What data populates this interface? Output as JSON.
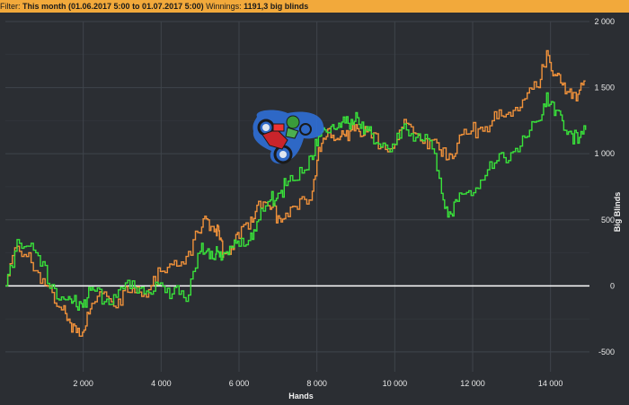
{
  "filter_bar": {
    "label": "Filter:",
    "period": "This month (01.06.2017 5:00 to 01.07.2017 5:00)",
    "winnings_label": "Winnings:",
    "winnings_value": "1191,3 big blinds"
  },
  "colors": {
    "background": "#2b2e33",
    "grid": "#3f444b",
    "series_orange": "#f0913a",
    "series_green": "#39e23a",
    "zero_line": "#ffffff",
    "filter_bar": "#f2a93b"
  },
  "icons": {
    "mascot": "motorbike-rider-icon"
  },
  "chart_data": {
    "type": "line",
    "xlabel": "Hands",
    "ylabel": "Big Blinds",
    "xlim": [
      0,
      15000
    ],
    "ylim": [
      -650,
      2000
    ],
    "x_ticks": [
      2000,
      4000,
      6000,
      8000,
      10000,
      12000,
      14000
    ],
    "x_tick_labels": [
      "2 000",
      "4 000",
      "6 000",
      "8 000",
      "10 000",
      "12 000",
      "14 000"
    ],
    "y_ticks": [
      -500,
      0,
      500,
      1000,
      1500,
      2000
    ],
    "y_tick_labels": [
      "-500",
      "0",
      "500",
      "1 000",
      "1 500",
      "2 000"
    ],
    "grid": true,
    "zero_line": 0,
    "series": [
      {
        "color": "#f0913a",
        "x": [
          0,
          300,
          600,
          900,
          1200,
          1500,
          1700,
          1900,
          2100,
          2300,
          2600,
          2900,
          3200,
          3500,
          3800,
          4100,
          4400,
          4700,
          5000,
          5200,
          5400,
          5500,
          5600,
          5800,
          6000,
          6300,
          6500,
          6800,
          7000,
          7200,
          7500,
          7800,
          8000,
          8200,
          8400,
          8600,
          8800,
          9000,
          9200,
          9400,
          9700,
          10000,
          10300,
          10600,
          10900,
          11200,
          11400,
          11600,
          11900,
          12200,
          12500,
          12800,
          13100,
          13400,
          13700,
          13900,
          14100,
          14300,
          14500,
          14700,
          14900
        ],
        "y": [
          0,
          300,
          250,
          20,
          -50,
          -150,
          -350,
          -380,
          -200,
          -120,
          -80,
          -100,
          -50,
          -80,
          70,
          100,
          150,
          260,
          400,
          500,
          430,
          350,
          250,
          300,
          360,
          520,
          640,
          580,
          530,
          550,
          580,
          650,
          950,
          1110,
          1140,
          1130,
          1100,
          1220,
          1140,
          1120,
          1080,
          1070,
          1230,
          1140,
          1100,
          980,
          1000,
          1080,
          1150,
          1200,
          1250,
          1280,
          1350,
          1460,
          1500,
          1780,
          1600,
          1520,
          1490,
          1450,
          1550
        ]
      },
      {
        "color": "#39e23a",
        "x": [
          0,
          300,
          600,
          900,
          1200,
          1500,
          1700,
          1900,
          2100,
          2300,
          2600,
          2900,
          3200,
          3500,
          3800,
          4100,
          4400,
          4700,
          5000,
          5200,
          5400,
          5500,
          5600,
          5800,
          6000,
          6300,
          6500,
          6800,
          7000,
          7200,
          7500,
          7800,
          8000,
          8200,
          8400,
          8600,
          8800,
          9000,
          9200,
          9400,
          9700,
          10000,
          10300,
          10600,
          10900,
          11200,
          11400,
          11600,
          11900,
          12200,
          12500,
          12800,
          13100,
          13400,
          13700,
          13900,
          14100,
          14300,
          14500,
          14700,
          14900
        ],
        "y": [
          0,
          350,
          300,
          150,
          10,
          -100,
          -130,
          -120,
          -90,
          -40,
          -100,
          -30,
          -20,
          -10,
          -40,
          -50,
          0,
          -70,
          260,
          280,
          240,
          220,
          250,
          290,
          300,
          400,
          500,
          650,
          700,
          760,
          800,
          980,
          1060,
          1180,
          1220,
          1200,
          1230,
          1310,
          1150,
          1150,
          1080,
          1070,
          1180,
          1150,
          1100,
          700,
          560,
          640,
          720,
          800,
          890,
          970,
          1040,
          1130,
          1250,
          1460,
          1290,
          1250,
          1170,
          1080,
          1180
        ]
      }
    ]
  }
}
